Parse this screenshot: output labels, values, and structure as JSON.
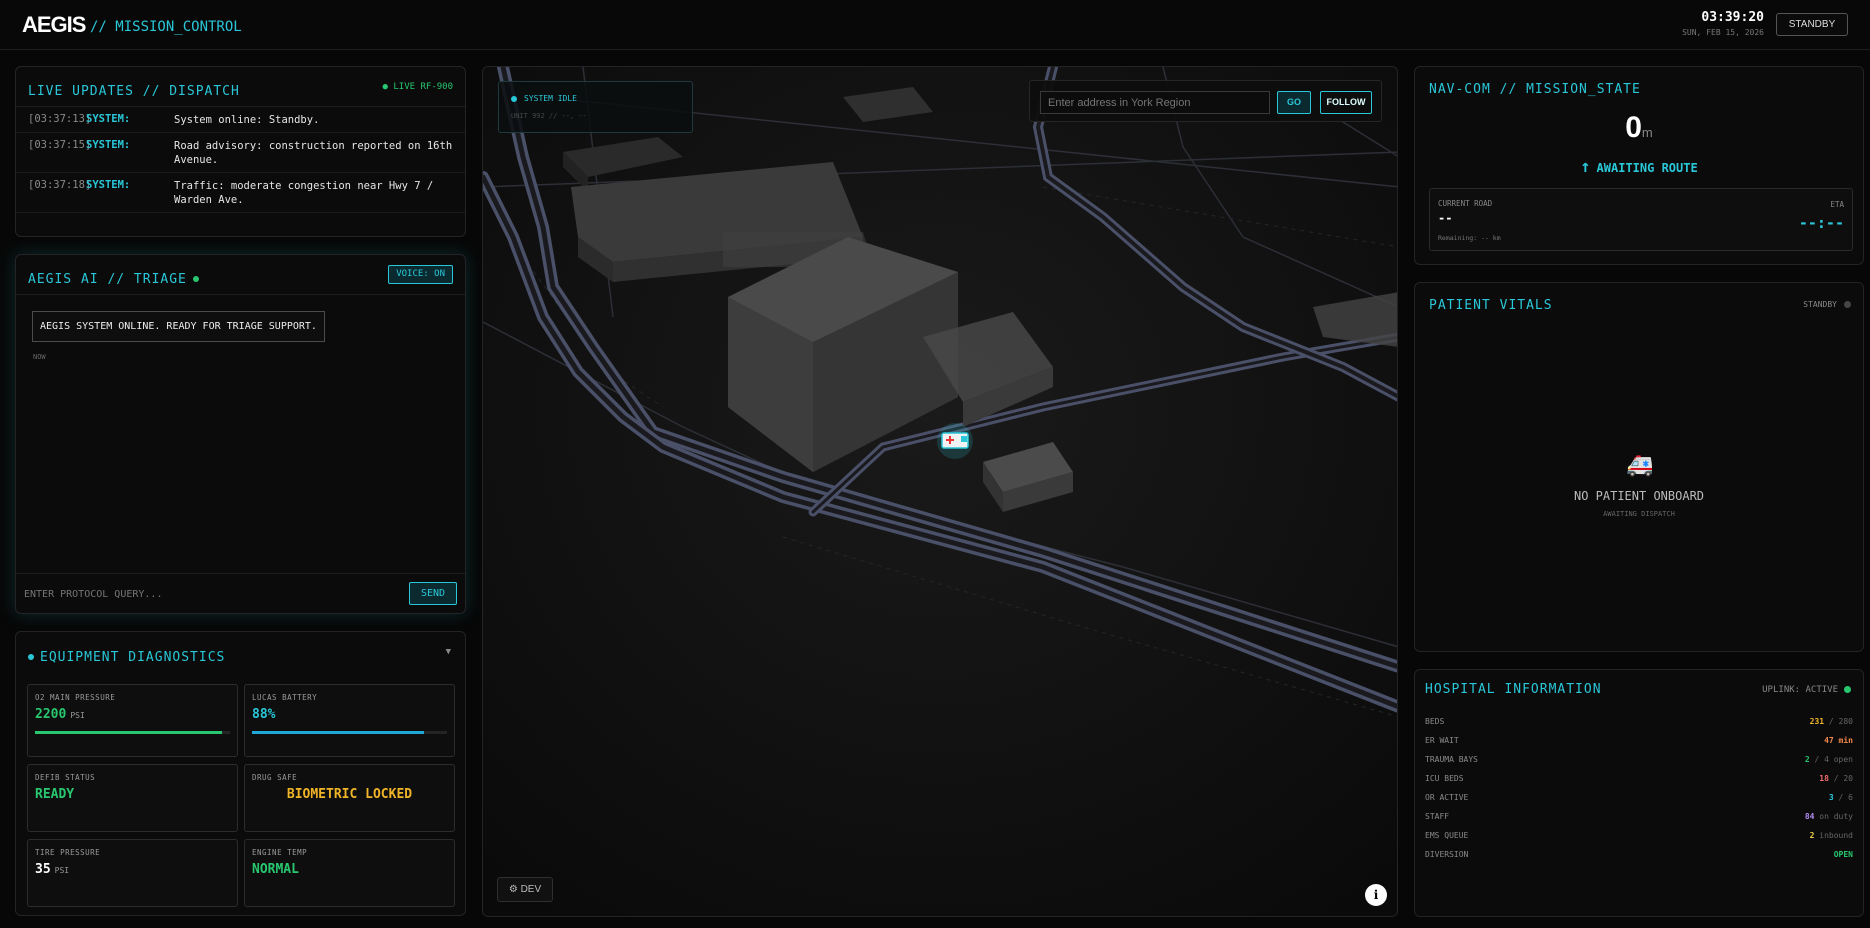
{
  "header": {
    "brand": "AEGIS",
    "subtitle": "// MISSION_CONTROL",
    "time": "03:39:20",
    "date": "SUN, FEB 15, 2026",
    "status_button": "STANDBY"
  },
  "live_updates": {
    "title": "LIVE UPDATES // DISPATCH",
    "tag": "● LIVE RF-900",
    "entries": [
      {
        "ts": "[03:37:13]",
        "who": "SYSTEM:",
        "msg": "System online: Standby."
      },
      {
        "ts": "[03:37:15]",
        "who": "SYSTEM:",
        "msg": "Road advisory: construction reported on 16th Avenue."
      },
      {
        "ts": "[03:37:18]",
        "who": "SYSTEM:",
        "msg": "Traffic: moderate congestion near Hwy 7 / Warden Ave."
      }
    ]
  },
  "triage": {
    "title": "AEGIS AI // TRIAGE",
    "voice_button": "VOICE: ON",
    "message": "AEGIS SYSTEM ONLINE. READY FOR TRIAGE SUPPORT.",
    "message_time": "NOW",
    "query_placeholder": "ENTER PROTOCOL QUERY...",
    "send_button": "SEND"
  },
  "equipment": {
    "title": "EQUIPMENT DIAGNOSTICS",
    "o2": {
      "label": "O2 MAIN PRESSURE",
      "value": "2200",
      "unit": "PSI",
      "level": 0.96,
      "color": "#28c76f"
    },
    "lucas": {
      "label": "LUCAS BATTERY",
      "value": "88%",
      "level": 0.88,
      "color": "#1fa7d8"
    },
    "defib": {
      "label": "DEFIB STATUS",
      "value": "READY"
    },
    "drug": {
      "label": "DRUG SAFE",
      "value": "BIOMETRIC LOCKED"
    },
    "tire": {
      "label": "TIRE PRESSURE",
      "value": "35",
      "unit": "PSI"
    },
    "engine": {
      "label": "ENGINE TEMP",
      "value": "NORMAL"
    }
  },
  "map": {
    "status": "SYSTEM IDLE",
    "unit": "UNIT 992 // --, --",
    "address_placeholder": "Enter address in York Region",
    "go_button": "GO",
    "follow_button": "FOLLOW",
    "dev_button": "⚙ DEV",
    "info_button": "i"
  },
  "navcom": {
    "title": "NAV-COM // MISSION_STATE",
    "distance": "0",
    "distance_unit": "m",
    "route_status": "AWAITING ROUTE",
    "route_icon": "↑",
    "current_road_label": "CURRENT ROAD",
    "current_road": "--",
    "remaining": "Remaining: -- km",
    "eta_label": "ETA",
    "eta": "--:--"
  },
  "vitals": {
    "title": "PATIENT VITALS",
    "status": "STANDBY",
    "icon": "🚑",
    "message": "NO PATIENT ONBOARD",
    "sub": "AWAITING DISPATCH"
  },
  "hospital": {
    "title": "HOSPITAL INFORMATION",
    "uplink": "UPLINK: ACTIVE",
    "rows": [
      {
        "key": "BEDS",
        "value": "231",
        "suffix": " / 280",
        "color": "#f0b429"
      },
      {
        "key": "ER WAIT",
        "value": "47 min",
        "suffix": "",
        "color": "#f2884b"
      },
      {
        "key": "TRAUMA BAYS",
        "value": "2",
        "suffix": " / 4 open",
        "color": "#28c76f"
      },
      {
        "key": "ICU BEDS",
        "value": "18",
        "suffix": " / 20",
        "color": "#f26d6d"
      },
      {
        "key": "OR ACTIVE",
        "value": "3",
        "suffix": " / 6",
        "color": "#2ac7d8"
      },
      {
        "key": "STAFF",
        "value": "84",
        "suffix": " on duty",
        "color": "#b38cf2"
      },
      {
        "key": "EMS QUEUE",
        "value": "2",
        "suffix": " inbound",
        "color": "#f0d04b"
      },
      {
        "key": "DIVERSION",
        "value": "OPEN",
        "suffix": "",
        "color": "#28c76f"
      }
    ]
  },
  "colors": {
    "accent": "#2ac7d8",
    "ok": "#28c76f",
    "warn": "#f0b429"
  }
}
